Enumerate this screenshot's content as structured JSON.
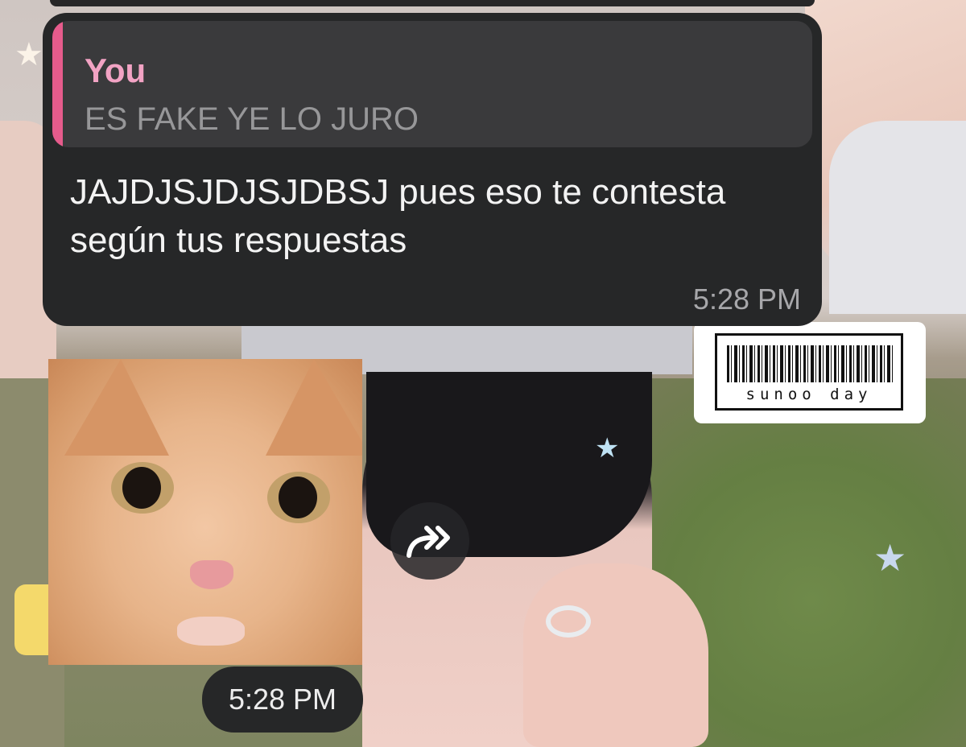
{
  "reply_message": {
    "quote": {
      "author": "You",
      "text": "ES FAKE YE LO JURO"
    },
    "text": "JAJDJSJDJSJDBSJ pues eso te contesta según tus respuestas",
    "time": "5:28 PM"
  },
  "sticker_message": {
    "time": "5:28 PM"
  },
  "wallpaper": {
    "barcode_text": "sunoo day"
  },
  "icons": {
    "forward": "forward-icon",
    "stars": "star-icon"
  },
  "colors": {
    "bubble": "#262728",
    "quote_accent": "#e65b8c",
    "quote_author": "#f2a3c4"
  }
}
